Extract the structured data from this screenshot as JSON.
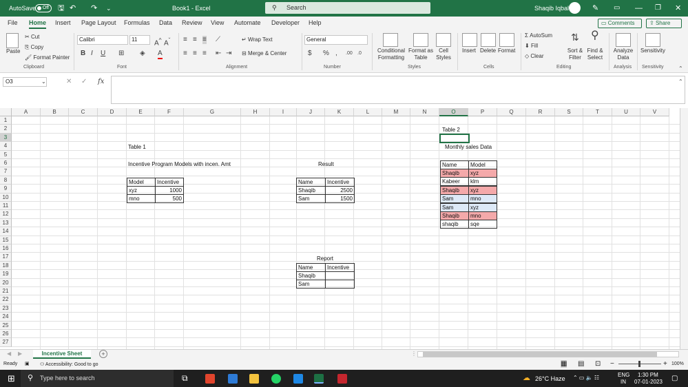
{
  "titlebar": {
    "autosave_label": "AutoSave",
    "autosave_state": "Off",
    "doc_title": "Book1  -  Excel",
    "search_placeholder": "Search",
    "user_name": "Shaqib Iqbal"
  },
  "menu": {
    "tabs": [
      "File",
      "Home",
      "Insert",
      "Page Layout",
      "Formulas",
      "Data",
      "Review",
      "View",
      "Automate",
      "Developer",
      "Help"
    ],
    "comments_label": "Comments",
    "share_label": "Share"
  },
  "ribbon": {
    "clipboard": {
      "paste": "Paste",
      "cut": "Cut",
      "copy": "Copy",
      "format_painter": "Format Painter",
      "group": "Clipboard"
    },
    "font": {
      "family": "Calibri",
      "size": "11",
      "group": "Font"
    },
    "alignment": {
      "wrap": "Wrap Text",
      "merge": "Merge & Center",
      "group": "Alignment"
    },
    "number": {
      "format": "General",
      "group": "Number"
    },
    "styles": {
      "conditional": "Conditional Formatting",
      "format_table": "Format as Table",
      "cell_styles": "Cell Styles",
      "group": "Styles"
    },
    "cells": {
      "insert": "Insert",
      "delete": "Delete",
      "format": "Format",
      "group": "Cells"
    },
    "editing": {
      "autosum": "AutoSum",
      "fill": "Fill",
      "clear": "Clear",
      "sort": "Sort & Filter",
      "find": "Find & Select",
      "group": "Editing"
    },
    "analysis": {
      "analyze": "Analyze Data",
      "group": "Analysis"
    },
    "sensitivity": {
      "label": "Sensitivity",
      "group": "Sensitivity"
    }
  },
  "formula_bar": {
    "name_box": "O3",
    "fx": "fx",
    "value": ""
  },
  "columns": [
    "A",
    "B",
    "C",
    "D",
    "E",
    "F",
    "G",
    "H",
    "I",
    "J",
    "K",
    "L",
    "M",
    "N",
    "O",
    "P",
    "Q",
    "R",
    "S",
    "T",
    "U",
    "V"
  ],
  "rows": [
    "1",
    "2",
    "3",
    "4",
    "5",
    "6",
    "7",
    "8",
    "9",
    "10",
    "11",
    "12",
    "13",
    "14",
    "15",
    "16",
    "17",
    "18",
    "19",
    "20",
    "21",
    "22",
    "23",
    "24",
    "25",
    "26",
    "27"
  ],
  "cells": {
    "table1_title": "Table 1",
    "models_title": "Incentive Program Models with incen. Amt",
    "models_header": [
      "Model",
      "Incentive"
    ],
    "models_rows": [
      [
        "xyz",
        "1000"
      ],
      [
        "mno",
        "500"
      ]
    ],
    "result_title": "Result",
    "result_header": [
      "Name",
      "Incentive"
    ],
    "result_rows": [
      [
        "Shaqib",
        "2500"
      ],
      [
        "Sam",
        "1500"
      ]
    ],
    "report_title": "Report",
    "report_header": [
      "Name",
      "Incentive"
    ],
    "report_rows": [
      [
        "Shaqib",
        ""
      ],
      [
        "Sam",
        ""
      ]
    ],
    "table2_title": "Table 2",
    "sales_title": "Monthly sales Data",
    "sales_header": [
      "Name",
      "Model"
    ],
    "sales_rows": [
      [
        "Shaqib",
        "xyz"
      ],
      [
        "Kabeer",
        "klm"
      ],
      [
        "Shaqib",
        "xyz"
      ],
      [
        "Sam",
        "mno"
      ],
      [
        "Sam",
        "xyz"
      ],
      [
        "Shaqib",
        "mno"
      ],
      [
        "shaqib",
        "sqe"
      ]
    ]
  },
  "sheet_tab": "Incentive Sheet",
  "status": {
    "ready": "Ready",
    "accessibility": "Accessibility: Good to go",
    "zoom": "100%"
  },
  "taskbar": {
    "search_placeholder": "Type here to search",
    "weather": "26°C  Haze",
    "lang1": "ENG",
    "lang2": "IN",
    "time": "1:30 PM",
    "date": "07-01-2023"
  },
  "colors": {
    "excel_green": "#217346",
    "pink": "#f4a9aa",
    "light_blue": "#dde9f7"
  }
}
